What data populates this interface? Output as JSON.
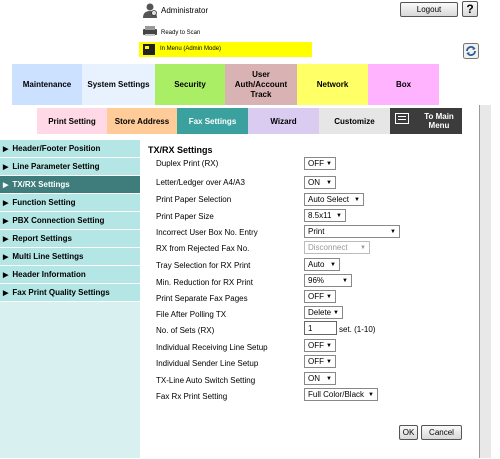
{
  "header": {
    "user_label": "Administrator",
    "logout_label": "Logout",
    "help_label": "?",
    "status_text": "Ready to Scan",
    "mode_text": "In Menu (Admin Mode)"
  },
  "main_tabs": [
    {
      "label": "Maintenance",
      "color": "#cce0ff"
    },
    {
      "label": "System Settings",
      "color": "#e8f2ff"
    },
    {
      "label": "Security",
      "color": "#aaee66"
    },
    {
      "label": "User Auth/Account Track",
      "color": "#d9b3b3"
    },
    {
      "label": "Network",
      "color": "#ffff66"
    },
    {
      "label": "Box",
      "color": "#ffb3ff"
    }
  ],
  "sub_tabs": [
    {
      "label": "Print Setting",
      "color": "#ffd9e6"
    },
    {
      "label": "Store Address",
      "color": "#ffcc99"
    },
    {
      "label": "Fax Settings",
      "color": "#3aa19e"
    },
    {
      "label": "Wizard",
      "color": "#d9ccf0"
    },
    {
      "label": "Customize",
      "color": "#e6e6e6"
    },
    {
      "label": "To Main Menu",
      "color": "#3c3c3c"
    }
  ],
  "sidebar": {
    "items": [
      {
        "label": "Header/Footer Position"
      },
      {
        "label": "Line Parameter Setting"
      },
      {
        "label": "TX/RX Settings"
      },
      {
        "label": "Function Setting"
      },
      {
        "label": "PBX Connection Setting"
      },
      {
        "label": "Report Settings"
      },
      {
        "label": "Multi Line Settings"
      },
      {
        "label": "Header Information"
      },
      {
        "label": "Fax Print Quality Settings"
      }
    ],
    "active_index": 2
  },
  "form": {
    "title": "TX/RX Settings",
    "rows": [
      {
        "label": "Duplex Print (RX)",
        "value": "OFF"
      },
      {
        "label": "Letter/Ledger over A4/A3",
        "value": "ON"
      },
      {
        "label": "Print Paper Selection",
        "value": "Auto Select"
      },
      {
        "label": "Print Paper Size",
        "value": "8.5x11"
      },
      {
        "label": "Incorrect User Box No. Entry",
        "value": "Print"
      },
      {
        "label": "RX from Rejected Fax No.",
        "value": "Disconnect"
      },
      {
        "label": "Tray Selection for RX Print",
        "value": "Auto"
      },
      {
        "label": "Min. Reduction for RX Print",
        "value": "96%"
      },
      {
        "label": "Print Separate Fax Pages",
        "value": "OFF"
      },
      {
        "label": "File After Polling TX",
        "value": "Delete"
      },
      {
        "label": "No. of Sets (RX)",
        "value": "1"
      },
      {
        "label": "Individual Receiving Line Setup",
        "value": "OFF"
      },
      {
        "label": "Individual Sender Line Setup",
        "value": "OFF"
      },
      {
        "label": "TX-Line Auto Switch Setting",
        "value": "ON"
      },
      {
        "label": "Fax Rx Print Setting",
        "value": "Full Color/Black"
      }
    ],
    "sets_hint": "set. (1-10)",
    "ok_label": "OK",
    "cancel_label": "Cancel"
  }
}
